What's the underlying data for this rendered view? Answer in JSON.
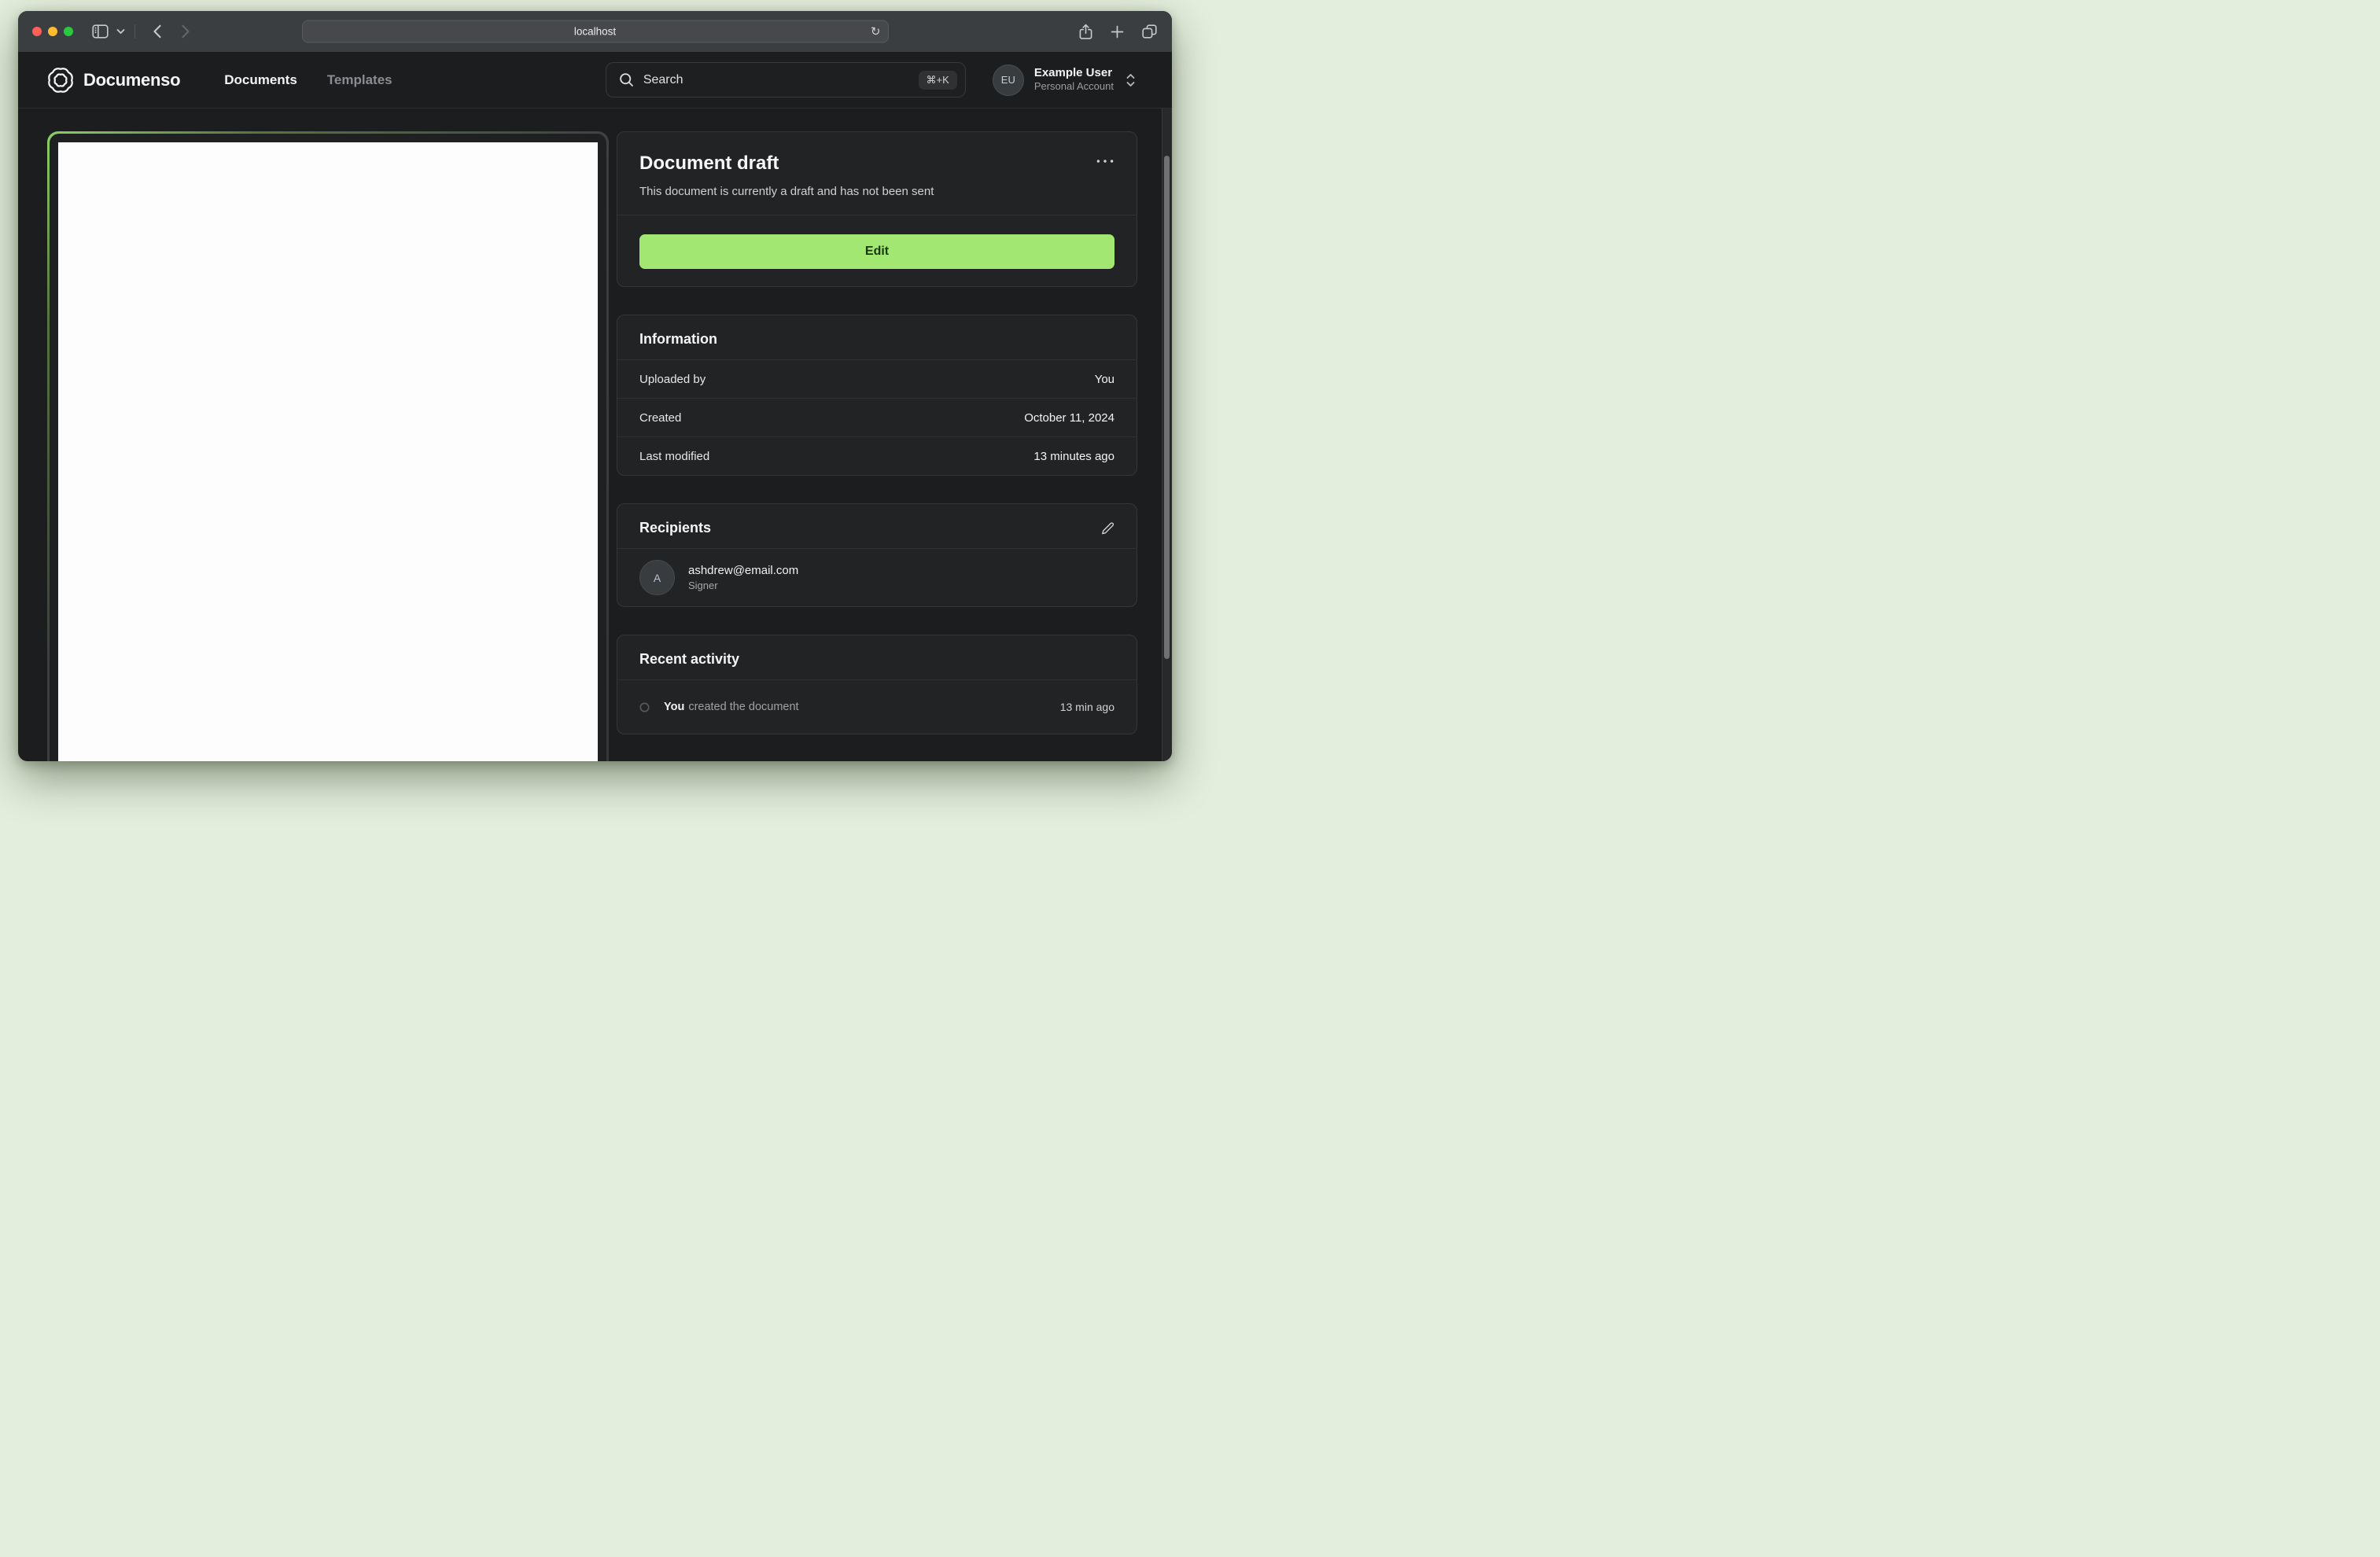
{
  "browser": {
    "url": "localhost",
    "traffic_lights": {
      "close": "#ff5f57",
      "minimize": "#febc2e",
      "zoom": "#29c841"
    }
  },
  "header": {
    "brand": "Documenso",
    "nav": [
      {
        "label": "Documents"
      },
      {
        "label": "Templates"
      }
    ],
    "search": {
      "placeholder": "Search",
      "shortcut": "⌘+K"
    },
    "user": {
      "initials": "EU",
      "name": "Example User",
      "account_type": "Personal Account"
    }
  },
  "document_card": {
    "title": "Document draft",
    "description": "This document is currently a draft and has not been sent",
    "edit_label": "Edit"
  },
  "information_card": {
    "title": "Information",
    "rows": [
      {
        "label": "Uploaded by",
        "value": "You"
      },
      {
        "label": "Created",
        "value": "October 11, 2024"
      },
      {
        "label": "Last modified",
        "value": "13 minutes ago"
      }
    ]
  },
  "recipients_card": {
    "title": "Recipients",
    "recipients": [
      {
        "initial": "A",
        "email": "ashdrew@email.com",
        "role": "Signer"
      }
    ]
  },
  "activity_card": {
    "title": "Recent activity",
    "items": [
      {
        "actor": "You",
        "action": "created the document",
        "time": "13 min ago"
      }
    ]
  },
  "glyphs": {
    "reload": "↻"
  },
  "colors": {
    "accent_green": "#a2e771",
    "accent_border_green": "#8dd065",
    "page_bg": "#1c1d1f",
    "outer_bg": "#e3eedc"
  }
}
